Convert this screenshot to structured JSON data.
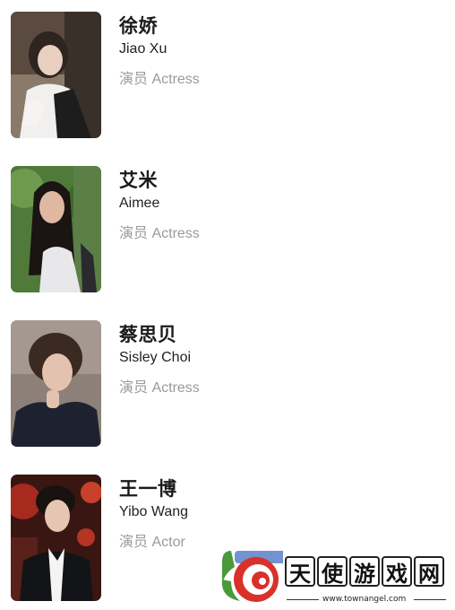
{
  "cast": [
    {
      "name_cn": "徐娇",
      "name_en": "Jiao Xu",
      "role": "演员 Actress"
    },
    {
      "name_cn": "艾米",
      "name_en": "Aimee",
      "role": "演员 Actress"
    },
    {
      "name_cn": "蔡思贝",
      "name_en": "Sisley Choi",
      "role": "演员 Actress"
    },
    {
      "name_cn": "王一博",
      "name_en": "Yibo Wang",
      "role": "演员 Actor"
    }
  ],
  "watermark": {
    "chars": [
      "天",
      "使",
      "游",
      "戏",
      "网"
    ],
    "url": "www.townangel.com"
  },
  "colors": {
    "name": "#1b1b1b",
    "subtitle": "#222222",
    "role": "#9a9a9a",
    "watermark_red": "#d8312a",
    "watermark_green": "#4a9a3a"
  }
}
